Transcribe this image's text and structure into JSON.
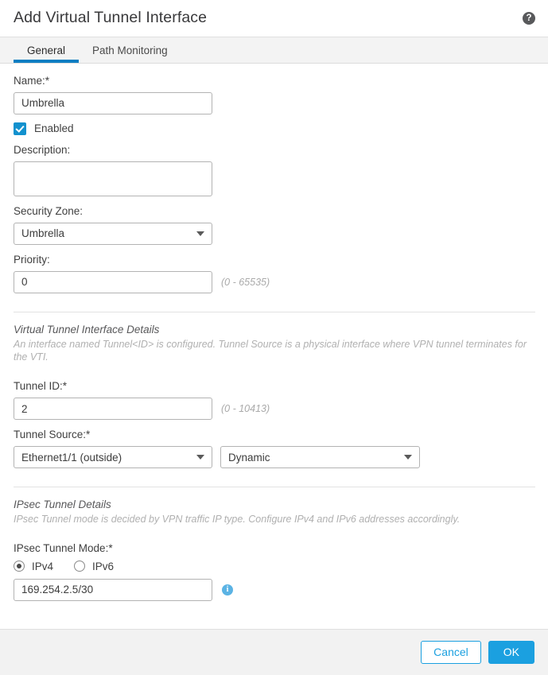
{
  "header": {
    "title": "Add Virtual Tunnel Interface",
    "help_icon": "help-circle-icon",
    "help_glyph": "?"
  },
  "tabs": [
    {
      "label": "General",
      "active": true
    },
    {
      "label": "Path Monitoring",
      "active": false
    }
  ],
  "general": {
    "name_label": "Name:*",
    "name_value": "Umbrella",
    "enabled_label": "Enabled",
    "enabled_checked": true,
    "description_label": "Description:",
    "description_value": "",
    "security_zone_label": "Security Zone:",
    "security_zone_value": "Umbrella",
    "priority_label": "Priority:",
    "priority_value": "0",
    "priority_hint": "(0 - 65535)"
  },
  "vti_section": {
    "title": "Virtual Tunnel Interface Details",
    "description": "An interface named Tunnel<ID> is configured. Tunnel Source is a physical interface where VPN tunnel terminates for the VTI.",
    "tunnel_id_label": "Tunnel ID:*",
    "tunnel_id_value": "2",
    "tunnel_id_hint": "(0 - 10413)",
    "tunnel_source_label": "Tunnel Source:*",
    "tunnel_source_interface": "Ethernet1/1 (outside)",
    "tunnel_source_mode": "Dynamic"
  },
  "ipsec_section": {
    "title": "IPsec Tunnel Details",
    "description": "IPsec Tunnel mode is decided by VPN traffic IP type. Configure IPv4 and IPv6 addresses accordingly.",
    "mode_label": "IPsec Tunnel Mode:*",
    "ipv4_label": "IPv4",
    "ipv6_label": "IPv6",
    "selected_mode": "IPv4",
    "address_value": "169.254.2.5/30",
    "info_glyph": "i"
  },
  "footer": {
    "cancel_label": "Cancel",
    "ok_label": "OK"
  },
  "colors": {
    "accent_blue": "#1ba0e0",
    "tab_underline": "#0d7ec2",
    "checkbox_blue": "#1291ce",
    "info_blue": "#5bb3e4"
  }
}
